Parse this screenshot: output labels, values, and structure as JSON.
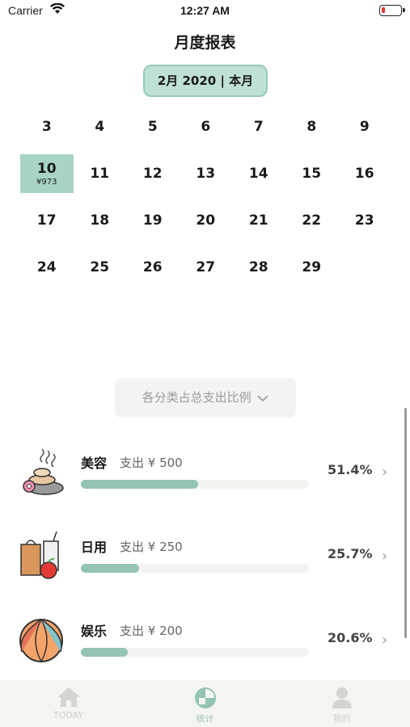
{
  "status_bar": {
    "carrier": "Carrier",
    "time": "12:27 AM"
  },
  "header": {
    "title": "月度报表"
  },
  "month_selector": {
    "label": "2月 2020 | 本月"
  },
  "calendar": {
    "rows": [
      [
        {
          "day": "3"
        },
        {
          "day": "4"
        },
        {
          "day": "5"
        },
        {
          "day": "6"
        },
        {
          "day": "7"
        },
        {
          "day": "8"
        },
        {
          "day": "9"
        }
      ],
      [
        {
          "day": "10",
          "amount": "¥973",
          "selected": true
        },
        {
          "day": "11"
        },
        {
          "day": "12"
        },
        {
          "day": "13"
        },
        {
          "day": "14"
        },
        {
          "day": "15"
        },
        {
          "day": "16"
        }
      ],
      [
        {
          "day": "17"
        },
        {
          "day": "18"
        },
        {
          "day": "19"
        },
        {
          "day": "20"
        },
        {
          "day": "21"
        },
        {
          "day": "22"
        },
        {
          "day": "23"
        }
      ],
      [
        {
          "day": "24"
        },
        {
          "day": "25"
        },
        {
          "day": "26"
        },
        {
          "day": "27"
        },
        {
          "day": "28"
        },
        {
          "day": "29"
        }
      ]
    ]
  },
  "category_dropdown": {
    "label": "各分类占总支出比例"
  },
  "categories": [
    {
      "name": "美容",
      "spend": "支出 ¥ 500",
      "percent": "51.4%",
      "fraction": 0.514,
      "icon": "spa-stones-icon"
    },
    {
      "name": "日用",
      "spend": "支出 ¥ 250",
      "percent": "25.7%",
      "fraction": 0.257,
      "icon": "groceries-icon"
    },
    {
      "name": "娱乐",
      "spend": "支出 ¥ 200",
      "percent": "20.6%",
      "fraction": 0.206,
      "icon": "beach-ball-icon"
    }
  ],
  "tab_bar": {
    "tabs": [
      {
        "label": "TODAY",
        "icon": "home-icon",
        "active": false
      },
      {
        "label": "统计",
        "icon": "stats-icon",
        "active": true
      },
      {
        "label": "我的",
        "icon": "profile-icon",
        "active": false
      }
    ]
  },
  "colors": {
    "accent": "#a8d4c4",
    "bar": "#94c4b3",
    "battery_low": "#e53935"
  }
}
